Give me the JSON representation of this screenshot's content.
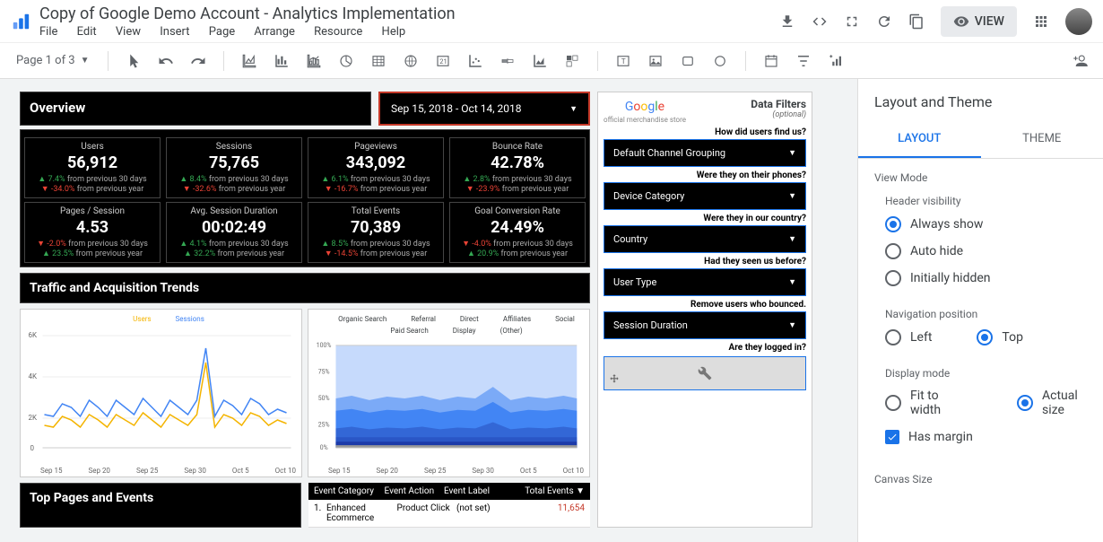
{
  "header": {
    "title": "Copy of Google Demo Account - Analytics Implementation",
    "menu": [
      "File",
      "Edit",
      "View",
      "Insert",
      "Page",
      "Arrange",
      "Resource",
      "Help"
    ],
    "view_btn": "VIEW"
  },
  "toolbar": {
    "page_select": "Page 1 of 3"
  },
  "side": {
    "title": "Layout and Theme",
    "tabs": {
      "layout": "LAYOUT",
      "theme": "THEME"
    },
    "view_mode": "View Mode",
    "header_vis": "Header visibility",
    "hv_opts": [
      "Always show",
      "Auto hide",
      "Initially hidden"
    ],
    "nav_pos": "Navigation position",
    "nav_opts": {
      "left": "Left",
      "top": "Top"
    },
    "disp_mode": "Display mode",
    "disp_opts": {
      "fit": "Fit to width",
      "actual": "Actual size"
    },
    "has_margin": "Has margin",
    "canvas_size": "Canvas Size"
  },
  "dash": {
    "overview": "Overview",
    "date_range": "Sep 15, 2018 - Oct 14, 2018",
    "traffic_title": "Traffic and Acquisition Trends",
    "top_pages": "Top Pages and Events",
    "filters_title": "Data Filters",
    "filters_opt": "(optional)",
    "store_sub": "official merchandise store",
    "filter_qs": [
      "How did users find us?",
      "Were they on their phones?",
      "Were they in our country?",
      "Had they seen us before?",
      "Remove users who bounced.",
      "Are they logged in?"
    ],
    "filter_sels": [
      "Default Channel Grouping",
      "Device Category",
      "Country",
      "User Type",
      "Session Duration"
    ],
    "kpis_top": [
      {
        "label": "Users",
        "value": "56,912",
        "d1": "7.4%",
        "d1dir": "up",
        "d1txt": "from previous 30 days",
        "d2": "-34.0%",
        "d2dir": "down",
        "d2txt": "from previous year"
      },
      {
        "label": "Sessions",
        "value": "75,765",
        "d1": "8.4%",
        "d1dir": "up",
        "d1txt": "from previous 30 days",
        "d2": "-32.6%",
        "d2dir": "down",
        "d2txt": "from previous year"
      },
      {
        "label": "Pageviews",
        "value": "343,092",
        "d1": "6.1%",
        "d1dir": "up",
        "d1txt": "from previous 30 days",
        "d2": "-16.7%",
        "d2dir": "down",
        "d2txt": "from previous year"
      },
      {
        "label": "Bounce Rate",
        "value": "42.78%",
        "d1": "2.8%",
        "d1dir": "up",
        "d1txt": "from previous 30 days",
        "d2": "-23.9%",
        "d2dir": "down",
        "d2txt": "from previous year"
      }
    ],
    "kpis_bot": [
      {
        "label": "Pages / Session",
        "value": "4.53",
        "d1": "-2.0%",
        "d1dir": "down",
        "d1txt": "from previous 30 days",
        "d2": "23.5%",
        "d2dir": "up",
        "d2txt": "from previous year"
      },
      {
        "label": "Avg. Session Duration",
        "value": "00:02:49",
        "d1": "4.1%",
        "d1dir": "up",
        "d1txt": "from previous 30 days",
        "d2": "32.2%",
        "d2dir": "up",
        "d2txt": "from previous year"
      },
      {
        "label": "Total Events",
        "value": "70,389",
        "d1": "8.5%",
        "d1dir": "up",
        "d1txt": "from previous 30 days",
        "d2": "-14.5%",
        "d2dir": "down",
        "d2txt": "from previous year"
      },
      {
        "label": "Goal Conversion Rate",
        "value": "24.49%",
        "d1": "-4.0%",
        "d1dir": "down",
        "d1txt": "from previous 30 days",
        "d2": "20.9%",
        "d2dir": "up",
        "d2txt": "from previous year"
      }
    ],
    "legend1": [
      "Users",
      "Sessions"
    ],
    "legend2": [
      "Organic Search",
      "Referral",
      "Direct",
      "Affiliates",
      "Social",
      "Paid Search",
      "Display",
      "(Other)"
    ],
    "x_ticks": [
      "Sep 15",
      "Sep 20",
      "Sep 25",
      "Sep 30",
      "Oct 5",
      "Oct 10"
    ],
    "event_hdr": {
      "cat": "Event Category",
      "action": "Event Action",
      "label": "Event Label",
      "total": "Total Events ▼"
    },
    "event_row1": {
      "num": "1.",
      "cat": "Enhanced Ecommerce",
      "action": "Product Click",
      "label": "(not set)",
      "total": "11,654"
    }
  },
  "chart_data": [
    {
      "type": "line",
      "title": "Users & Sessions over 30 days",
      "x": [
        "Sep 15",
        "Sep 20",
        "Sep 25",
        "Sep 30",
        "Oct 5",
        "Oct 10"
      ],
      "series": [
        {
          "name": "Users",
          "values": [
            1800,
            1700,
            2200,
            2000,
            1600,
            2300,
            2000,
            1600,
            2300,
            2000,
            1700,
            2400,
            2000,
            1600,
            2300,
            2000,
            1700,
            2300,
            4800,
            1600,
            2300,
            2100,
            1700,
            2400,
            2200,
            1700,
            2000,
            1800,
            1600,
            2100
          ]
        },
        {
          "name": "Sessions",
          "values": [
            2300,
            2200,
            2900,
            2700,
            2200,
            3100,
            2700,
            2200,
            3100,
            2700,
            2300,
            3200,
            2700,
            2200,
            3100,
            2700,
            2300,
            3100,
            5300,
            2200,
            3100,
            2800,
            2300,
            3200,
            2900,
            2300,
            2700,
            2400,
            2200,
            2800
          ]
        }
      ],
      "ylim": [
        0,
        6000
      ],
      "yticks": [
        "0",
        "2K",
        "4K",
        "6K"
      ]
    },
    {
      "type": "area",
      "title": "Channel share over 30 days (stacked %)",
      "x": [
        "Sep 15",
        "Sep 20",
        "Sep 25",
        "Sep 30",
        "Oct 5",
        "Oct 10"
      ],
      "series": [
        {
          "name": "Organic Search",
          "values": [
            52,
            53,
            51,
            50,
            52,
            53,
            52,
            51,
            50,
            52,
            53,
            52,
            51,
            50,
            52,
            53,
            52,
            55,
            45,
            51,
            52,
            53,
            52,
            51,
            50,
            52,
            53,
            52,
            51,
            50
          ]
        },
        {
          "name": "Referral",
          "values": [
            13,
            13,
            14,
            14,
            13,
            13,
            14,
            14,
            13,
            13,
            14,
            14,
            13,
            13,
            14,
            13,
            13,
            12,
            16,
            14,
            13,
            13,
            14,
            14,
            13,
            13,
            14,
            14,
            13,
            14
          ]
        },
        {
          "name": "Direct",
          "values": [
            18,
            17,
            18,
            19,
            18,
            17,
            18,
            19,
            20,
            18,
            17,
            18,
            19,
            20,
            18,
            17,
            18,
            16,
            22,
            18,
            18,
            17,
            18,
            19,
            20,
            18,
            17,
            18,
            19,
            19
          ]
        },
        {
          "name": "Affiliates",
          "values": [
            5,
            5,
            5,
            5,
            5,
            5,
            5,
            5,
            5,
            5,
            5,
            5,
            5,
            5,
            5,
            5,
            5,
            5,
            5,
            5,
            5,
            5,
            5,
            5,
            5,
            5,
            5,
            5,
            5,
            5
          ]
        },
        {
          "name": "Social",
          "values": [
            5,
            5,
            5,
            5,
            5,
            5,
            4,
            4,
            5,
            5,
            5,
            4,
            5,
            5,
            4,
            5,
            5,
            5,
            5,
            5,
            5,
            5,
            4,
            4,
            5,
            5,
            4,
            4,
            5,
            5
          ]
        },
        {
          "name": "Paid Search",
          "values": [
            4,
            4,
            4,
            4,
            4,
            4,
            4,
            4,
            4,
            4,
            3,
            4,
            4,
            4,
            4,
            4,
            4,
            4,
            4,
            4,
            4,
            4,
            4,
            4,
            4,
            4,
            4,
            4,
            4,
            4
          ]
        },
        {
          "name": "Display",
          "values": [
            2,
            2,
            2,
            2,
            2,
            2,
            2,
            2,
            2,
            2,
            2,
            2,
            2,
            2,
            2,
            2,
            2,
            2,
            2,
            2,
            2,
            2,
            2,
            2,
            2,
            2,
            2,
            2,
            2,
            2
          ]
        },
        {
          "name": "(Other)",
          "values": [
            1,
            1,
            1,
            1,
            1,
            1,
            1,
            1,
            1,
            1,
            1,
            1,
            1,
            1,
            1,
            1,
            1,
            1,
            1,
            1,
            1,
            1,
            1,
            1,
            1,
            1,
            1,
            1,
            1,
            1
          ]
        }
      ],
      "ylim": [
        0,
        100
      ],
      "yticks": [
        "0%",
        "25%",
        "50%",
        "75%",
        "100%"
      ]
    }
  ]
}
